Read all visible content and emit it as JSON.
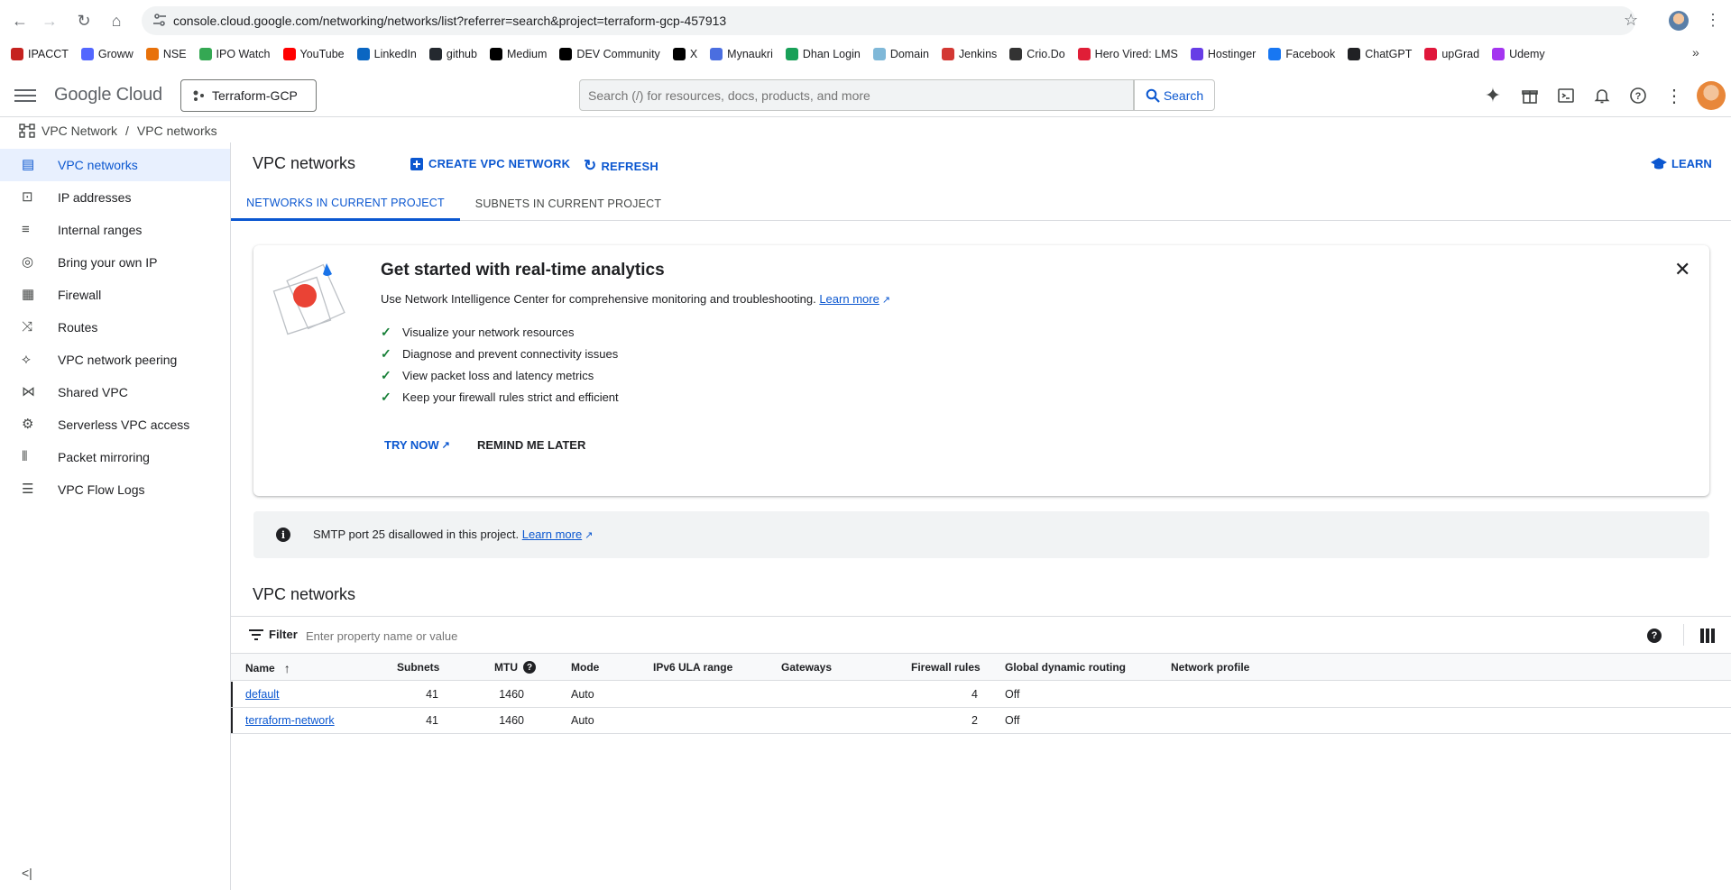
{
  "browser": {
    "url": "console.cloud.google.com/networking/networks/list?referrer=search&project=terraform-gcp-457913",
    "bookmarks": [
      {
        "label": "IPACCT",
        "color": "#c5221f"
      },
      {
        "label": "Groww",
        "color": "#5367ff"
      },
      {
        "label": "NSE",
        "color": "#e8710a"
      },
      {
        "label": "IPO Watch",
        "color": "#34a853"
      },
      {
        "label": "YouTube",
        "color": "#ff0000"
      },
      {
        "label": "LinkedIn",
        "color": "#0a66c2"
      },
      {
        "label": "github",
        "color": "#24292f"
      },
      {
        "label": "Medium",
        "color": "#000000"
      },
      {
        "label": "DEV Community",
        "color": "#000000"
      },
      {
        "label": "X",
        "color": "#000000"
      },
      {
        "label": "Mynaukri",
        "color": "#4a6ee0"
      },
      {
        "label": "Dhan Login",
        "color": "#18a058"
      },
      {
        "label": "Domain",
        "color": "#7fb8d8"
      },
      {
        "label": "Jenkins",
        "color": "#d33833"
      },
      {
        "label": "Crio.Do",
        "color": "#333333"
      },
      {
        "label": "Hero Vired: LMS",
        "color": "#e01e37"
      },
      {
        "label": "Hostinger",
        "color": "#673de6"
      },
      {
        "label": "Facebook",
        "color": "#1877f2"
      },
      {
        "label": "ChatGPT",
        "color": "#202124"
      },
      {
        "label": "upGrad",
        "color": "#e0173b"
      },
      {
        "label": "Udemy",
        "color": "#a435f0"
      }
    ],
    "more": "»"
  },
  "header": {
    "logo_google": "Google",
    "logo_cloud": "Cloud",
    "project": "Terraform-GCP",
    "search_placeholder": "Search (/) for resources, docs, products, and more",
    "search_button": "Search"
  },
  "breadcrumb": {
    "root": "VPC Network",
    "separator": "/",
    "current": "VPC networks"
  },
  "sidebar": {
    "items": [
      {
        "label": "VPC networks",
        "icon": "vpc-networks-icon",
        "active": true
      },
      {
        "label": "IP addresses",
        "icon": "ip-addresses-icon"
      },
      {
        "label": "Internal ranges",
        "icon": "internal-ranges-icon"
      },
      {
        "label": "Bring your own IP",
        "icon": "globe-icon"
      },
      {
        "label": "Firewall",
        "icon": "firewall-icon"
      },
      {
        "label": "Routes",
        "icon": "routes-icon"
      },
      {
        "label": "VPC network peering",
        "icon": "peering-icon"
      },
      {
        "label": "Shared VPC",
        "icon": "shared-vpc-icon"
      },
      {
        "label": "Serverless VPC access",
        "icon": "serverless-icon"
      },
      {
        "label": "Packet mirroring",
        "icon": "packet-mirroring-icon"
      },
      {
        "label": "VPC Flow Logs",
        "icon": "flow-logs-icon"
      }
    ]
  },
  "page": {
    "title": "VPC networks",
    "create_button": "CREATE VPC NETWORK",
    "refresh_button": "REFRESH",
    "learn_button": "LEARN",
    "tabs": [
      {
        "label": "NETWORKS IN CURRENT PROJECT",
        "active": true
      },
      {
        "label": "SUBNETS IN CURRENT PROJECT"
      }
    ]
  },
  "promo": {
    "title": "Get started with real-time analytics",
    "description": "Use Network Intelligence Center for comprehensive monitoring and troubleshooting.",
    "learn_more": "Learn more",
    "checks": [
      "Visualize your network resources",
      "Diagnose and prevent connectivity issues",
      "View packet loss and latency metrics",
      "Keep your firewall rules strict and efficient"
    ],
    "try_now": "TRY NOW",
    "remind_later": "REMIND ME LATER"
  },
  "smtp": {
    "text": "SMTP port 25 disallowed in this project.",
    "learn_more": "Learn more"
  },
  "table": {
    "section_title": "VPC networks",
    "filter_label": "Filter",
    "filter_placeholder": "Enter property name or value",
    "columns": [
      "Name",
      "Subnets",
      "MTU",
      "Mode",
      "IPv6 ULA range",
      "Gateways",
      "Firewall rules",
      "Global dynamic routing",
      "Network profile"
    ],
    "rows": [
      {
        "name": "default",
        "subnets": "41",
        "mtu": "1460",
        "mode": "Auto",
        "ipv6": "",
        "gateways": "",
        "firewall_rules": "4",
        "routing": "Off",
        "profile": ""
      },
      {
        "name": "terraform-network",
        "subnets": "41",
        "mtu": "1460",
        "mode": "Auto",
        "ipv6": "",
        "gateways": "",
        "firewall_rules": "2",
        "routing": "Off",
        "profile": ""
      }
    ]
  }
}
